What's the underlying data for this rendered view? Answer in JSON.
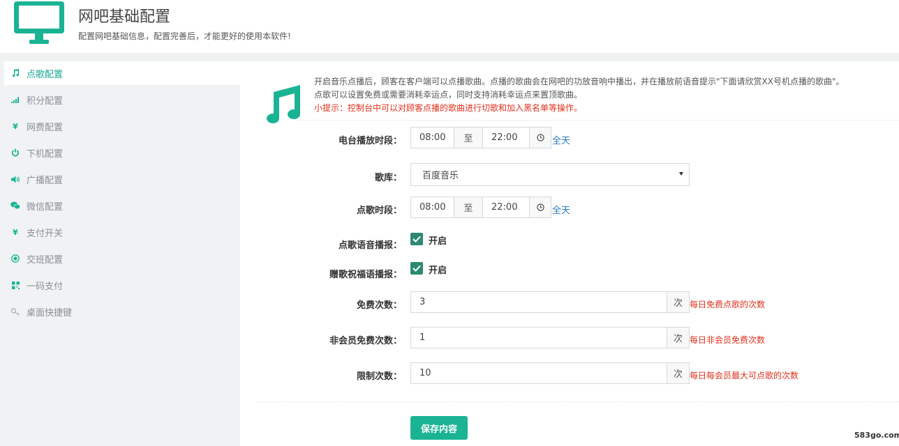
{
  "header": {
    "title": "网吧基础配置",
    "subtitle": "配置网吧基础信息，配置完善后，才能更好的使用本软件!",
    "icon": "monitor-icon"
  },
  "sidebar": {
    "items": [
      {
        "label": "点歌配置",
        "icon": "music-icon",
        "active": true
      },
      {
        "label": "积分配置",
        "icon": "signal-icon",
        "active": false
      },
      {
        "label": "网费配置",
        "icon": "yen-icon",
        "active": false
      },
      {
        "label": "下机配置",
        "icon": "power-icon",
        "active": false
      },
      {
        "label": "广播配置",
        "icon": "volume-icon",
        "active": false
      },
      {
        "label": "微信配置",
        "icon": "wechat-icon",
        "active": false
      },
      {
        "label": "支付开关",
        "icon": "yen-icon",
        "active": false
      },
      {
        "label": "交班配置",
        "icon": "target-icon",
        "active": false
      },
      {
        "label": "一码支付",
        "icon": "qrcode-icon",
        "active": false
      },
      {
        "label": "桌面快捷键",
        "icon": "key-icon",
        "active": false
      }
    ]
  },
  "intro": {
    "line1": "开启音乐点播后，顾客在客户端可以点播歌曲。点播的歌曲会在网吧的功放音响中播出，并在播放前语音提示\"下面请欣赏XX号机点播的歌曲\"。",
    "line2": "点歌可以设置免费或需要消耗幸运点，同时支持消耗幸运点来置顶歌曲。",
    "warning": "小提示：控制台中可以对顾客点播的歌曲进行切歌和加入黑名单等操作。"
  },
  "form": {
    "radio_time": {
      "label": "电台播放时段：",
      "start": "08:00",
      "to": "至",
      "end": "22:00",
      "all_day": "全天"
    },
    "library": {
      "label": "歌库：",
      "value": "百度音乐"
    },
    "song_time": {
      "label": "点歌时段：",
      "start": "08:00",
      "to": "至",
      "end": "22:00",
      "all_day": "全天"
    },
    "voice_broadcast": {
      "label": "点歌语音播报：",
      "checked": true,
      "text": "开启"
    },
    "gift_broadcast": {
      "label": "赠歌祝福语播报：",
      "checked": true,
      "text": "开启"
    },
    "free_count": {
      "label": "免费次数：",
      "value": "3",
      "unit": "次",
      "hint": "每日免费点歌的次数"
    },
    "nonmember_free": {
      "label": "非会员免费次数：",
      "value": "1",
      "unit": "次",
      "hint": "每日非会员免费次数"
    },
    "limit_count": {
      "label": "限制次数：",
      "value": "10",
      "unit": "次",
      "hint": "每日每会员最大可点歌的次数"
    },
    "save_label": "保存内容"
  },
  "watermark": "583go.com",
  "colors": {
    "accent": "#1ab394",
    "warning": "#e0301e",
    "link": "#2a7ac0",
    "checkbox": "#2c8a73"
  }
}
